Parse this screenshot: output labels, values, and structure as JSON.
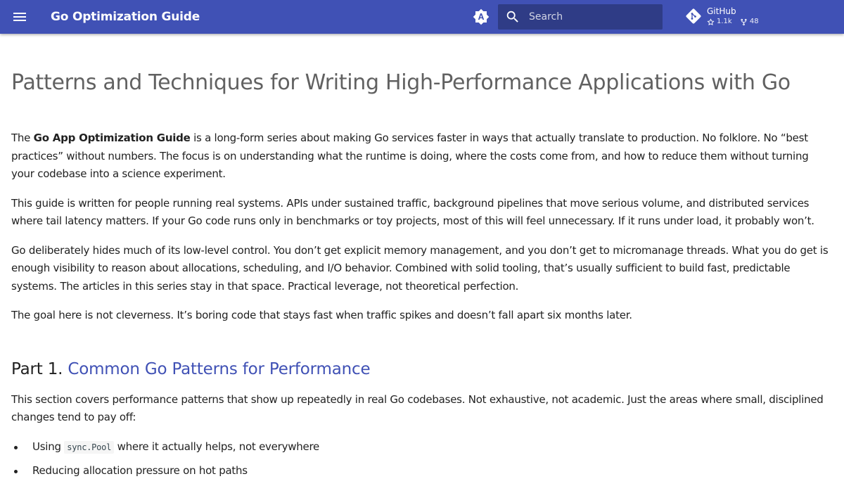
{
  "colors": {
    "header_bg": "#4051b5",
    "link": "#4051b5",
    "title": "#616161",
    "text": "#212121"
  },
  "header": {
    "menu_icon": "hamburger-menu-icon",
    "title": "Go Optimization Guide",
    "theme_icon": "brightness-auto-icon",
    "search": {
      "icon": "search-icon",
      "placeholder": "Search"
    },
    "repo": {
      "icon": "git-icon",
      "name": "GitHub",
      "stars": "1.1k",
      "forks": "48"
    }
  },
  "page": {
    "title": "Patterns and Techniques for Writing High-Performance Applications with Go",
    "intro": {
      "p1_before": "The ",
      "p1_bold": "Go App Optimization Guide",
      "p1_after": " is a long-form series about making Go services faster in ways that actually translate to production. No folklore. No “best practices” without numbers. The focus is on understanding what the runtime is doing, where the costs come from, and how to reduce them without turning your codebase into a science experiment.",
      "p2": "This guide is written for people running real systems. APIs under sustained traffic, background pipelines that move serious volume, and distributed services where tail latency matters. If your Go code runs only in benchmarks or toy projects, most of this will feel unnecessary. If it runs under load, it probably won’t.",
      "p3": "Go deliberately hides much of its low-level control. You don’t get explicit memory management, and you don’t get to micromanage threads. What you do get is enough visibility to reason about allocations, scheduling, and I/O behavior. Combined with solid tooling, that’s usually sufficient to build fast, predictable systems. The articles in this series stay in that space. Practical leverage, not theoretical perfection.",
      "p4": "The goal here is not cleverness. It’s boring code that stays fast when traffic spikes and doesn’t fall apart six months later."
    },
    "part1": {
      "prefix": "Part 1. ",
      "link": "Common Go Patterns for Performance",
      "description": "This section covers performance patterns that show up repeatedly in real Go codebases. Not exhaustive, not academic. Just the areas where small, disciplined changes tend to pay off:",
      "items": [
        {
          "before": "Using ",
          "code": "sync.Pool",
          "after": " where it actually helps, not everywhere"
        },
        {
          "before": "Reducing allocation pressure on hot paths",
          "code": "",
          "after": ""
        }
      ]
    }
  }
}
